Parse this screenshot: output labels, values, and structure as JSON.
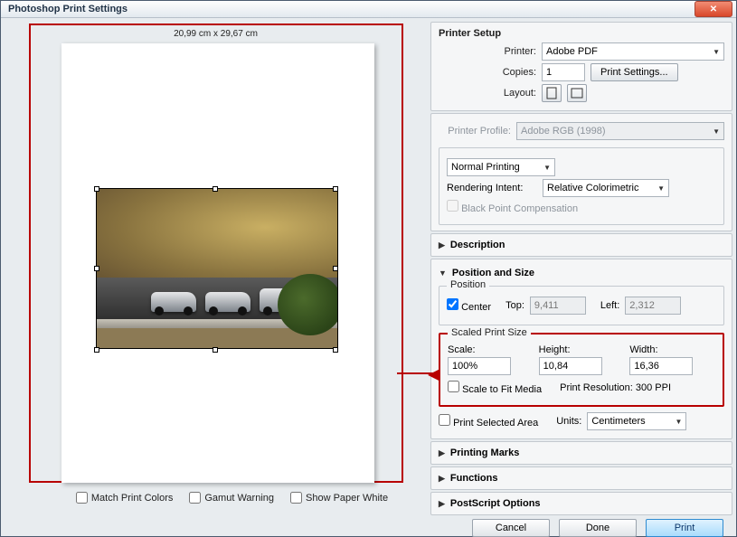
{
  "window": {
    "title": "Photoshop Print Settings"
  },
  "preview": {
    "page_dimensions": "20,99 cm x 29,67 cm"
  },
  "bottom": {
    "match": "Match Print Colors",
    "gamut": "Gamut Warning",
    "paper": "Show Paper White"
  },
  "printerSetup": {
    "title": "Printer Setup",
    "printer_lbl": "Printer:",
    "printer_val": "Adobe PDF",
    "copies_lbl": "Copies:",
    "copies_val": "1",
    "settings_btn": "Print Settings...",
    "layout_lbl": "Layout:"
  },
  "colorMgmt": {
    "profile_lbl": "Printer Profile:",
    "profile_val": "Adobe RGB (1998)",
    "mode_val": "Normal Printing",
    "intent_lbl": "Rendering Intent:",
    "intent_val": "Relative Colorimetric",
    "bpc": "Black Point Compensation"
  },
  "sections": {
    "description": "Description",
    "position": "Position and Size",
    "marks": "Printing Marks",
    "functions": "Functions",
    "postscript": "PostScript Options"
  },
  "position": {
    "legend": "Position",
    "center": "Center",
    "top_lbl": "Top:",
    "top_val": "9,411",
    "left_lbl": "Left:",
    "left_val": "2,312"
  },
  "scaled": {
    "legend": "Scaled Print Size",
    "scale_lbl": "Scale:",
    "scale_val": "100%",
    "height_lbl": "Height:",
    "height_val": "10,84",
    "width_lbl": "Width:",
    "width_val": "16,36",
    "fit": "Scale to Fit Media",
    "res": "Print Resolution: 300 PPI"
  },
  "extra": {
    "selected": "Print Selected Area",
    "units_lbl": "Units:",
    "units_val": "Centimeters"
  },
  "footer": {
    "cancel": "Cancel",
    "done": "Done",
    "print": "Print"
  }
}
